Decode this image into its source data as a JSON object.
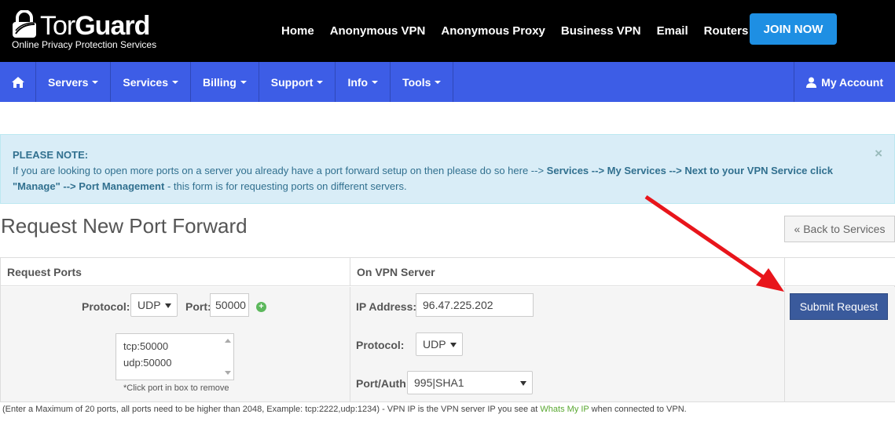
{
  "brand": {
    "name_tor": "Tor",
    "name_guard": "Guard",
    "tagline": "Online Privacy Protection Services"
  },
  "topnav": [
    "Home",
    "Anonymous VPN",
    "Anonymous Proxy",
    "Business VPN",
    "Email",
    "Routers"
  ],
  "join_label": "JOIN NOW",
  "navbar": {
    "items": [
      "Servers",
      "Services",
      "Billing",
      "Support",
      "Info",
      "Tools"
    ],
    "account": "My Account"
  },
  "alert": {
    "title": "PLEASE NOTE:",
    "text_1": "If you are looking to open more ports on a server you already have a port forward setup on then please do so here -->",
    "services": "Services",
    "arrow_1": "-->",
    "my_services": "My Services",
    "arrow_2": "-->",
    "next_to": "Next to your VPN Service click",
    "manage": "\"Manage\"",
    "arrow_3": "-->",
    "port_mgmt": "Port Management",
    "text_2": "- this form is for requesting ports on different servers.",
    "close": "×"
  },
  "page_title": "Request New Port Forward",
  "back_label": "« Back to Services",
  "table": {
    "col1_header": "Request Ports",
    "col2_header": "On VPN Server",
    "protocol_label": "Protocol:",
    "protocol_value": "UDP",
    "port_label": "Port:",
    "port_value": "50000",
    "ports_list": [
      "tcp:50000",
      "udp:50000"
    ],
    "hint": "*Click port in box to remove",
    "ip_label": "IP Address:",
    "ip_value": "96.47.225.202",
    "server_protocol_label": "Protocol:",
    "server_protocol_value": "UDP",
    "portauth_label": "Port/Auth:",
    "portauth_value": "995|SHA1",
    "submit_label": "Submit Request"
  },
  "footnote": {
    "text_1": "(Enter a Maximum of 20 ports, all ports need to be higher than 2048, Example: tcp:2222,udp:1234) - VPN IP is the VPN server IP you see at",
    "link": "Whats My IP",
    "text_2": "when connected to VPN."
  },
  "colors": {
    "header_bg": "#000000",
    "nav_bg": "#3d5de6",
    "join_bg": "#1e8fe3",
    "alert_bg": "#d9edf7",
    "submit_bg": "#3a5a9c",
    "arrow": "#e8151b"
  }
}
